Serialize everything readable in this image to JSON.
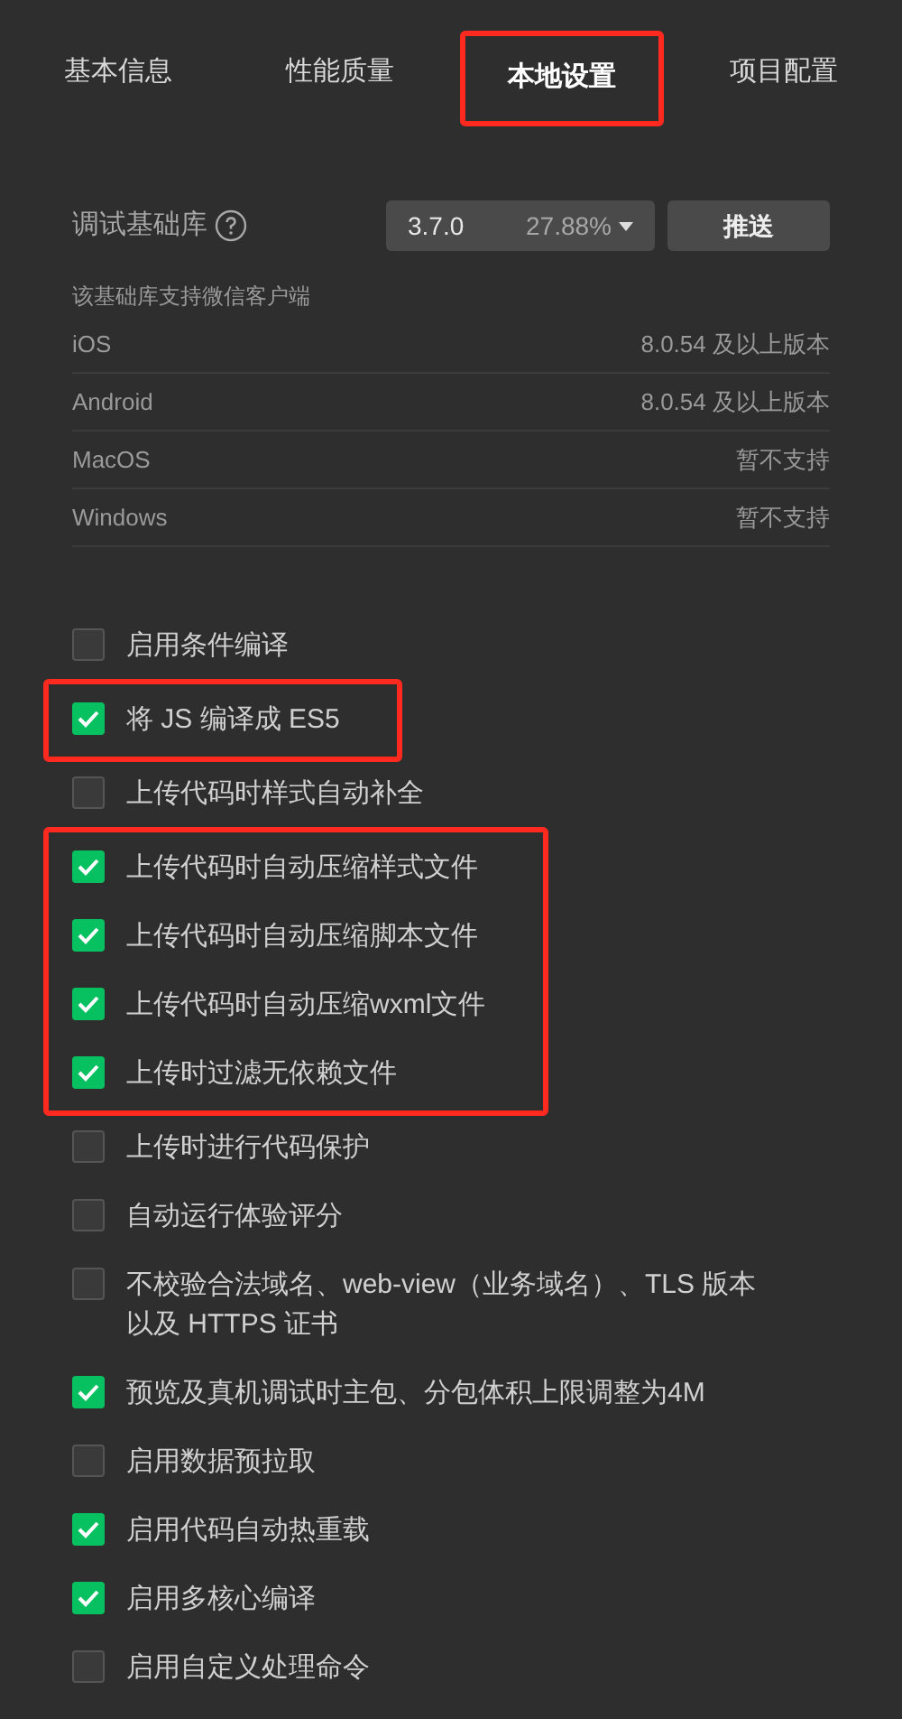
{
  "tabs": [
    {
      "label": "基本信息",
      "selected": false,
      "highlighted": false
    },
    {
      "label": "性能质量",
      "selected": false,
      "highlighted": false
    },
    {
      "label": "本地设置",
      "selected": true,
      "highlighted": true
    },
    {
      "label": "项目配置",
      "selected": false,
      "highlighted": false
    }
  ],
  "base_library": {
    "label": "调试基础库",
    "version": "3.7.0",
    "share": "27.88%",
    "push_button": "推送"
  },
  "support": {
    "title": "该基础库支持微信客户端",
    "rows": [
      {
        "platform": "iOS",
        "value": "8.0.54 及以上版本"
      },
      {
        "platform": "Android",
        "value": "8.0.54 及以上版本"
      },
      {
        "platform": "MacOS",
        "value": "暂不支持"
      },
      {
        "platform": "Windows",
        "value": "暂不支持"
      }
    ]
  },
  "options": [
    {
      "label": "启用条件编译",
      "checked": false,
      "highlighted": false
    },
    {
      "label": "将 JS 编译成 ES5",
      "checked": true,
      "highlighted": true
    },
    {
      "label": "上传代码时样式自动补全",
      "checked": false,
      "highlighted": false
    },
    {
      "label": "上传代码时自动压缩样式文件",
      "checked": true,
      "highlighted": true
    },
    {
      "label": "上传代码时自动压缩脚本文件",
      "checked": true,
      "highlighted": true
    },
    {
      "label": "上传代码时自动压缩wxml文件",
      "checked": true,
      "highlighted": true
    },
    {
      "label": "上传时过滤无依赖文件",
      "checked": true,
      "highlighted": true
    },
    {
      "label": "上传时进行代码保护",
      "checked": false,
      "highlighted": false
    },
    {
      "label": "自动运行体验评分",
      "checked": false,
      "highlighted": false
    },
    {
      "label": "不校验合法域名、web-view（业务域名）、TLS 版本以及 HTTPS 证书",
      "checked": false,
      "highlighted": false
    },
    {
      "label": "预览及真机调试时主包、分包体积上限调整为4M",
      "checked": true,
      "highlighted": false
    },
    {
      "label": "启用数据预拉取",
      "checked": false,
      "highlighted": false
    },
    {
      "label": "启用代码自动热重载",
      "checked": true,
      "highlighted": false
    },
    {
      "label": "启用多核心编译",
      "checked": true,
      "highlighted": false
    },
    {
      "label": "启用自定义处理命令",
      "checked": false,
      "highlighted": false
    }
  ]
}
